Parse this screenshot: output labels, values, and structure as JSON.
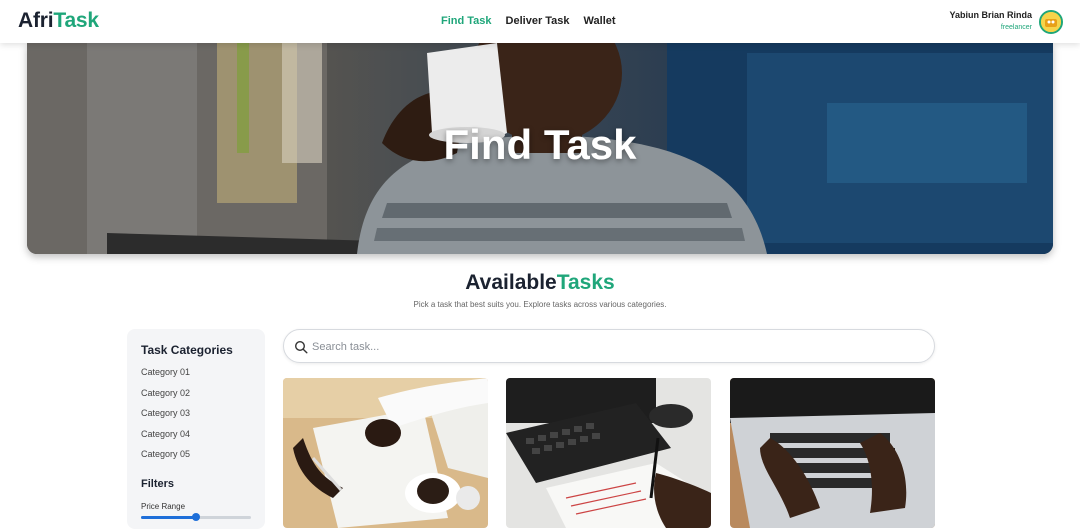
{
  "brand": {
    "part1": "Afri",
    "part2": "Task"
  },
  "nav": {
    "links": [
      {
        "label": "Find Task",
        "active": true
      },
      {
        "label": "Deliver Task",
        "active": false
      },
      {
        "label": "Wallet",
        "active": false
      }
    ]
  },
  "user": {
    "name": "Yabiun Brian Rinda",
    "role": "freelancer",
    "avatar_icon": "avatar-icon"
  },
  "hero": {
    "title": "Find Task"
  },
  "section": {
    "title_part1": "Available",
    "title_part2": "Tasks",
    "subtitle": "Pick a task that best suits you. Explore tasks across various categories."
  },
  "sidebar": {
    "heading": "Task Categories",
    "categories": [
      "Category 01",
      "Category 02",
      "Category 03",
      "Category 04",
      "Category 05"
    ],
    "filters_heading": "Filters",
    "price_label": "Price Range",
    "price_range_fraction": 0.5
  },
  "search": {
    "placeholder": "Search task...",
    "value": "",
    "icon": "search-icon"
  },
  "cards": [
    {
      "image": "writing-on-paper-with-coffee"
    },
    {
      "image": "keyboard-and-handwritten-notes"
    },
    {
      "image": "typing-on-laptop"
    }
  ],
  "colors": {
    "accent": "#1fa67a",
    "dark": "#1b2230",
    "slider": "#1e6fd9"
  }
}
